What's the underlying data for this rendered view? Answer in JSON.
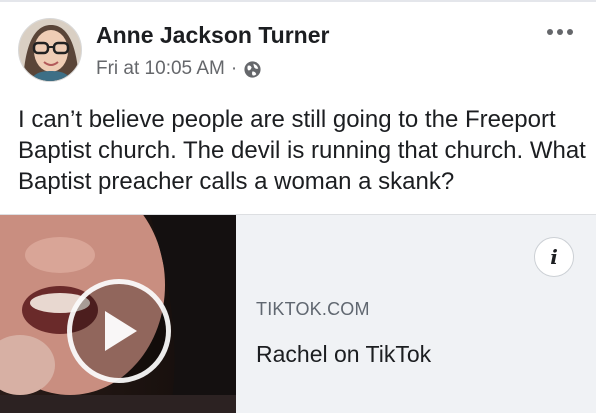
{
  "post": {
    "author": "Anne Jackson Turner",
    "timestamp": "Fri at 10:05 AM",
    "separator": "·",
    "privacy_icon": "globe-icon",
    "more_icon": "more-options-icon",
    "text": "I can’t believe people are still going to the Freeport Baptist church. The devil is running that church. What Baptist preacher calls a woman a skank?"
  },
  "link_preview": {
    "domain": "TIKTOK.COM",
    "title": "Rachel on TikTok",
    "info_icon": "info-icon",
    "info_label": "i",
    "play_icon": "play-icon"
  },
  "colors": {
    "text_primary": "#1c1e21",
    "text_secondary": "#65676b",
    "preview_bg": "#f0f2f5"
  }
}
